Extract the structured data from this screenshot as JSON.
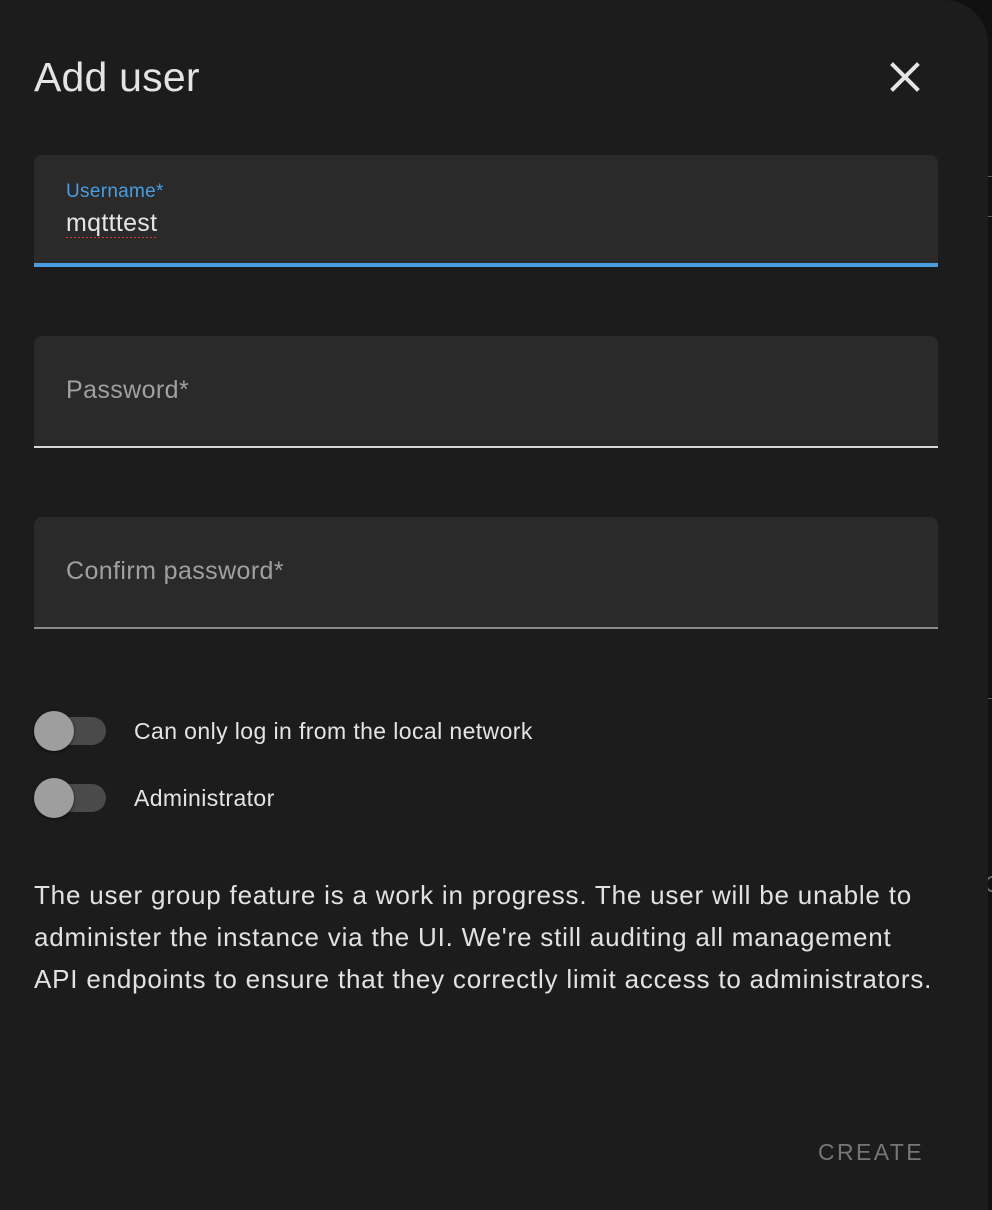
{
  "dialog": {
    "title": "Add user",
    "close_icon": "close-icon"
  },
  "fields": {
    "username": {
      "label": "Username*",
      "value": "mqtttest"
    },
    "password": {
      "label": "Password*",
      "value": ""
    },
    "confirm_password": {
      "label": "Confirm password*",
      "value": ""
    }
  },
  "toggles": [
    {
      "label": "Can only log in from the local network",
      "checked": false
    },
    {
      "label": "Administrator",
      "checked": false
    }
  ],
  "info": {
    "text": "The user group feature is a work in progress. The user will be unable to administer the instance via the UI. We're still auditing all management API endpoints to ensure that they correctly limit access to administrators."
  },
  "actions": {
    "create_label": "CREATE"
  },
  "colors": {
    "accent": "#4a9de0",
    "dialog_bg": "#1c1c1c",
    "field_bg": "#2a2a2a",
    "disabled_text": "#767676"
  }
}
